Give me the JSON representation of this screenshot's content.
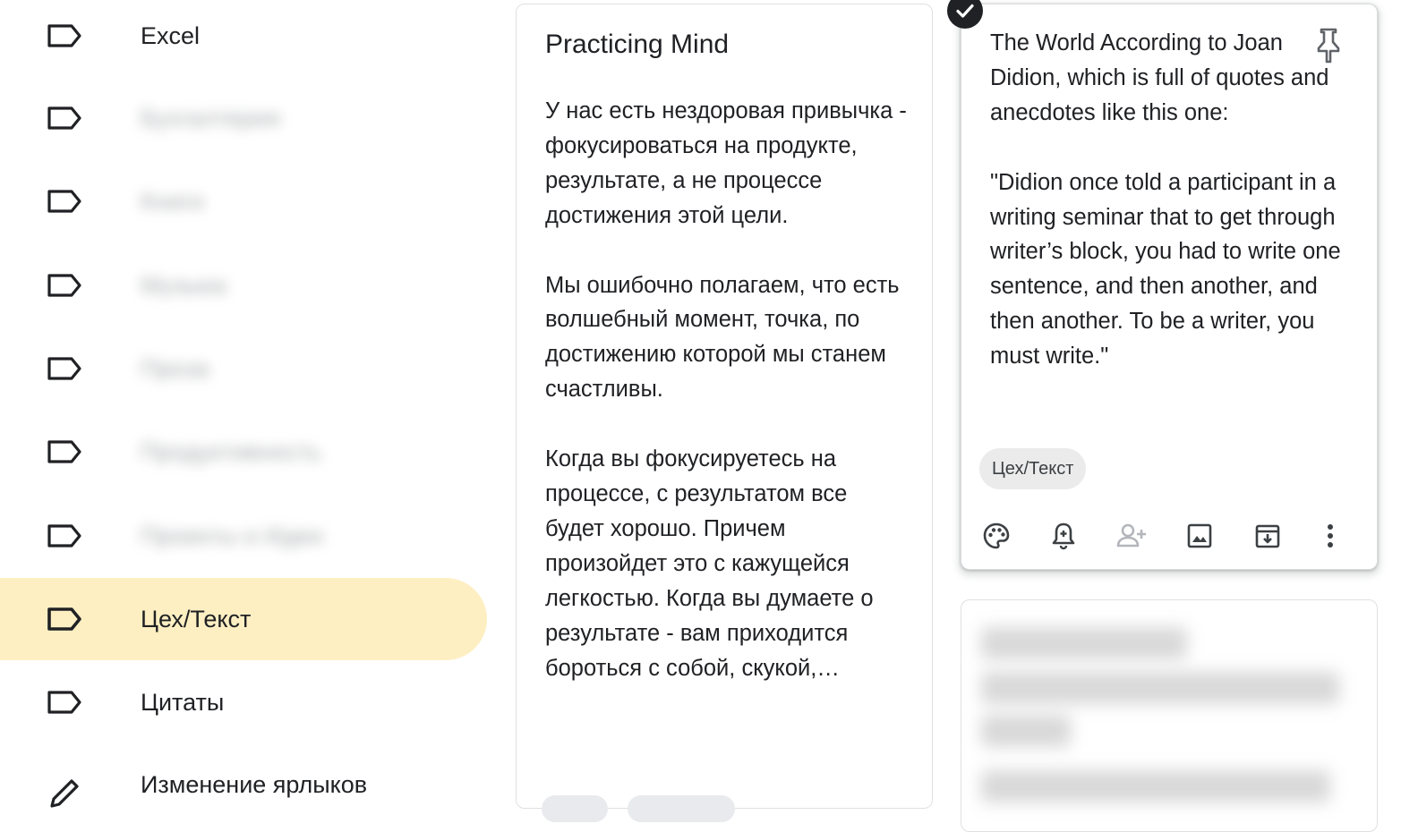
{
  "sidebar": {
    "items": [
      {
        "label": "Excel"
      },
      {
        "label": "Бухгалтерия"
      },
      {
        "label": "Книги"
      },
      {
        "label": "Музыка"
      },
      {
        "label": "Проза"
      },
      {
        "label": "Продуктивность"
      },
      {
        "label": "Проекты и Идеи"
      },
      {
        "label": "Цех/Текст"
      },
      {
        "label": "Цитаты"
      }
    ],
    "edit_labels": "Изменение ярлыков"
  },
  "note1": {
    "title": "Practicing Mind",
    "body": "У нас есть нездоровая привычка - фокусироваться на продукте, результате, а не процессе достижения этой цели.\n\nМы ошибочно полагаем, что есть волшебный момент, точка, по достижению которой мы станем счастливы.\n\nКогда вы фокусируетесь на процессе, с результатом все будет хорошо. Причем произойдет это с кажущейся легкостью. Когда вы думаете о результате - вам приходится бороться с собой, скукой,…"
  },
  "note2": {
    "body": "The World According to Joan Didion, which is full of quotes and anecdotes like this one:\n\n\"Didion once told a participant in a writing seminar that to get through writer’s block, you had to write one sentence, and then another, and then another. To be a writer, you must write.\"",
    "label_chip": "Цех/Текст",
    "toolbar_icons": [
      "palette-icon",
      "reminder-icon",
      "collaborator-icon",
      "image-icon",
      "archive-icon",
      "more-icon"
    ]
  },
  "colors": {
    "active_nav": "#feefc3",
    "text": "#202124",
    "icon": "#5f6368",
    "chip": "#ebebeb"
  }
}
